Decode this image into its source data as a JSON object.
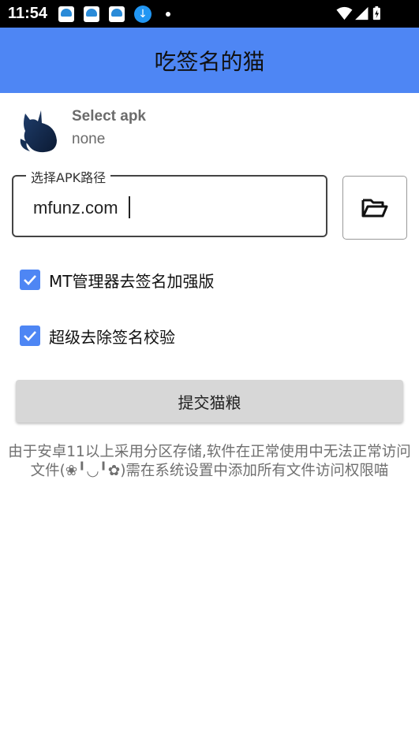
{
  "status_bar": {
    "time": "11:54",
    "download_glyph": "↓"
  },
  "app_bar": {
    "title": "吃签名的猫"
  },
  "apk": {
    "title": "Select apk",
    "value": "none"
  },
  "path_field": {
    "label": "选择APK路径",
    "value": "mfunz.com"
  },
  "options": [
    {
      "label": "MT管理器去签名加强版",
      "checked": true
    },
    {
      "label": "超级去除签名校验",
      "checked": true
    }
  ],
  "submit": {
    "label": "提交猫粮"
  },
  "notice": {
    "text": "由于安卓11以上采用分区存储,软件在正常使用中无法正常访问文件(❀╹◡╹✿)需在系统设置中添加所有文件访问权限喵"
  },
  "colors": {
    "accent": "#4e86f4",
    "status_bar": "#000000",
    "button": "#d7d7d7"
  }
}
